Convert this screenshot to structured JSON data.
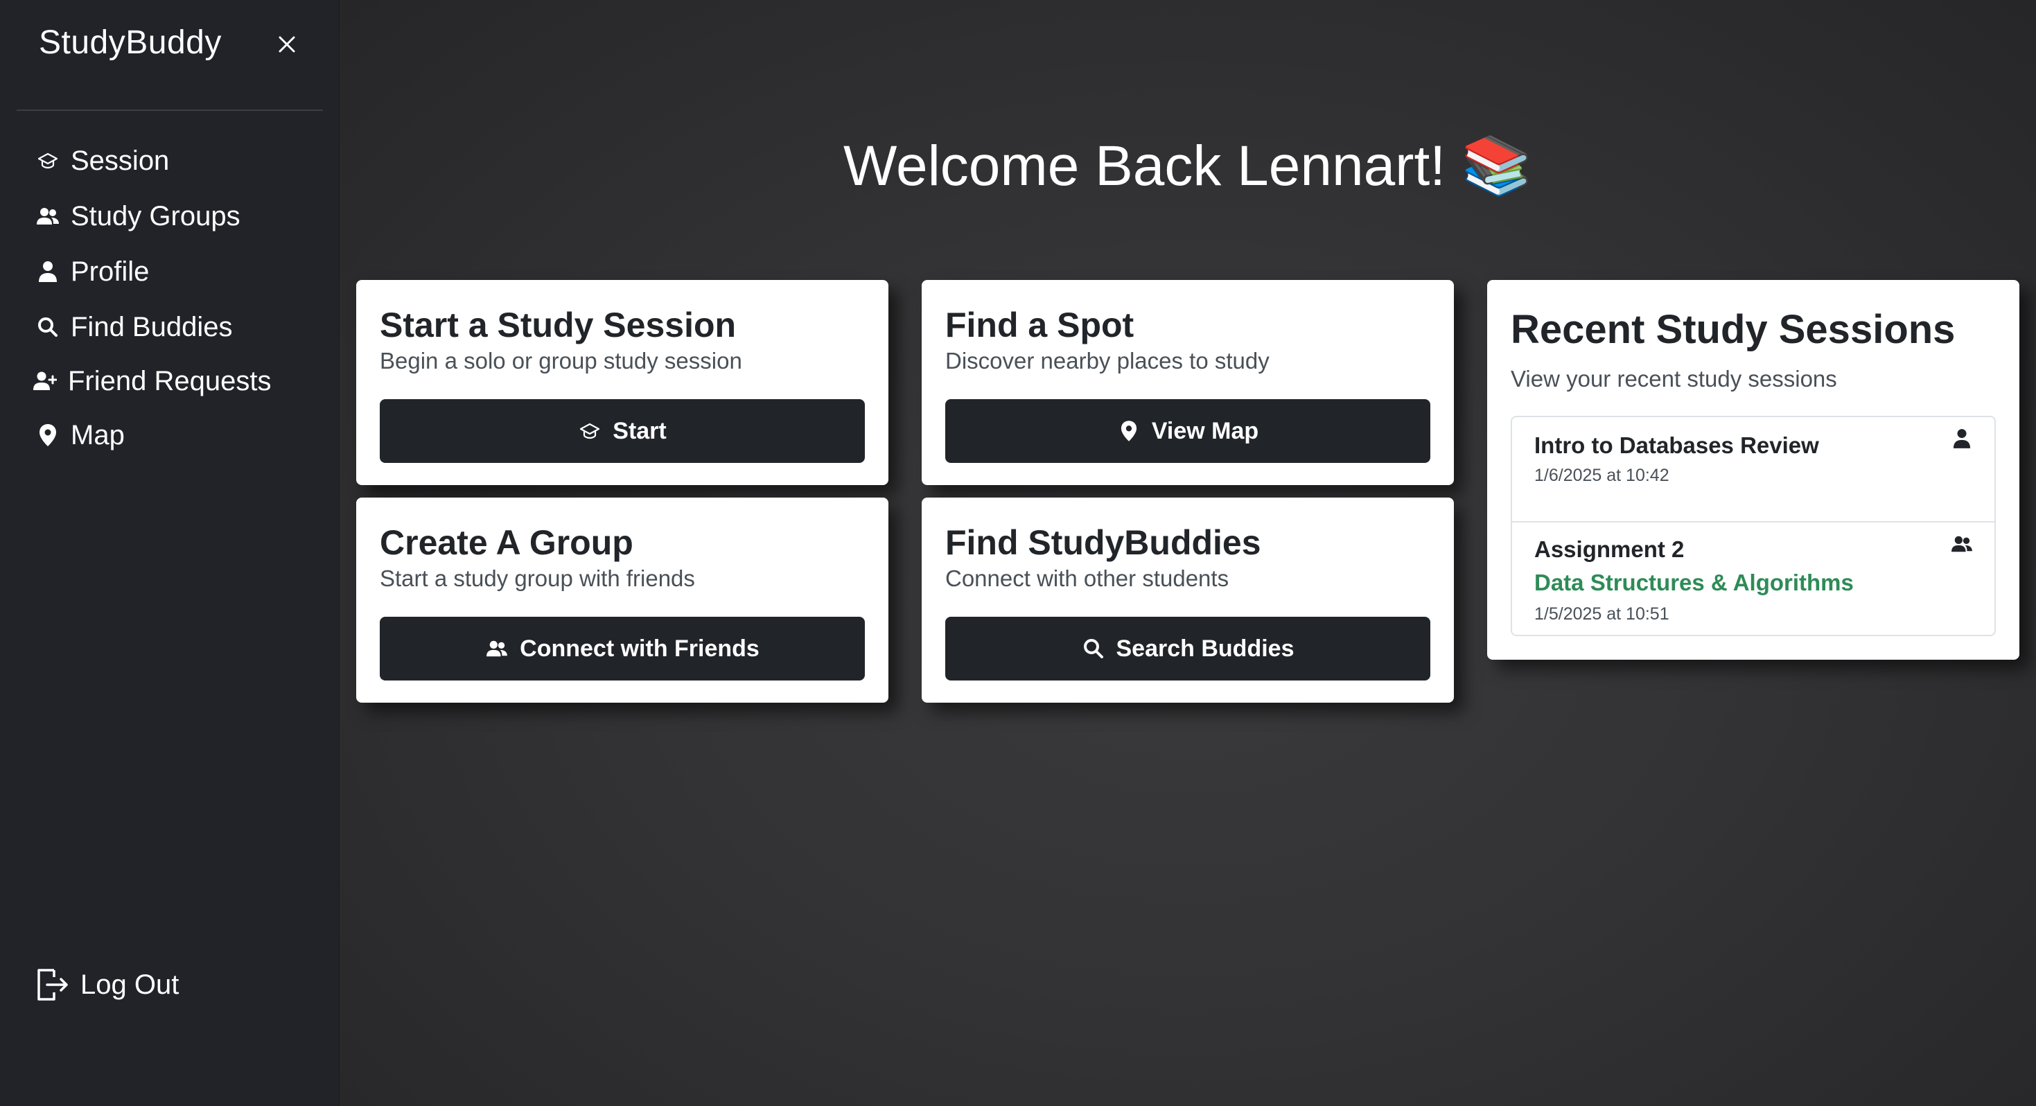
{
  "sidebar": {
    "brand": "StudyBuddy",
    "items": [
      {
        "label": "Session",
        "icon": "graduation-cap-icon"
      },
      {
        "label": "Study Groups",
        "icon": "people-icon"
      },
      {
        "label": "Profile",
        "icon": "person-icon"
      },
      {
        "label": "Find Buddies",
        "icon": "search-icon"
      },
      {
        "label": "Friend Requests",
        "icon": "person-add-icon"
      },
      {
        "label": "Map",
        "icon": "map-pin-icon"
      }
    ],
    "logout_label": "Log Out"
  },
  "main": {
    "welcome": "Welcome Back Lennart! 📚",
    "cards": [
      {
        "title": "Start a Study Session",
        "subtitle": "Begin a solo or group study session",
        "button": "Start",
        "icon": "graduation-cap-icon"
      },
      {
        "title": "Find a Spot",
        "subtitle": "Discover nearby places to study",
        "button": "View Map",
        "icon": "map-pin-icon"
      },
      {
        "title": "Create A Group",
        "subtitle": "Start a study group with friends",
        "button": "Connect with Friends",
        "icon": "people-icon"
      },
      {
        "title": "Find StudyBuddies",
        "subtitle": "Connect with other students",
        "button": "Search Buddies",
        "icon": "search-icon"
      }
    ],
    "recent": {
      "title": "Recent Study Sessions",
      "subtitle": "View your recent study sessions",
      "sessions": [
        {
          "title": "Intro to Databases Review",
          "course": "",
          "date": "1/6/2025 at 10:42",
          "icon": "person-icon"
        },
        {
          "title": "Assignment 2",
          "course": "Data Structures & Algorithms",
          "date": "1/5/2025 at 10:51",
          "icon": "people-icon"
        }
      ]
    }
  },
  "colors": {
    "sidebar_bg": "#212329",
    "button_bg": "#212529",
    "course_green": "#2e8b57"
  }
}
